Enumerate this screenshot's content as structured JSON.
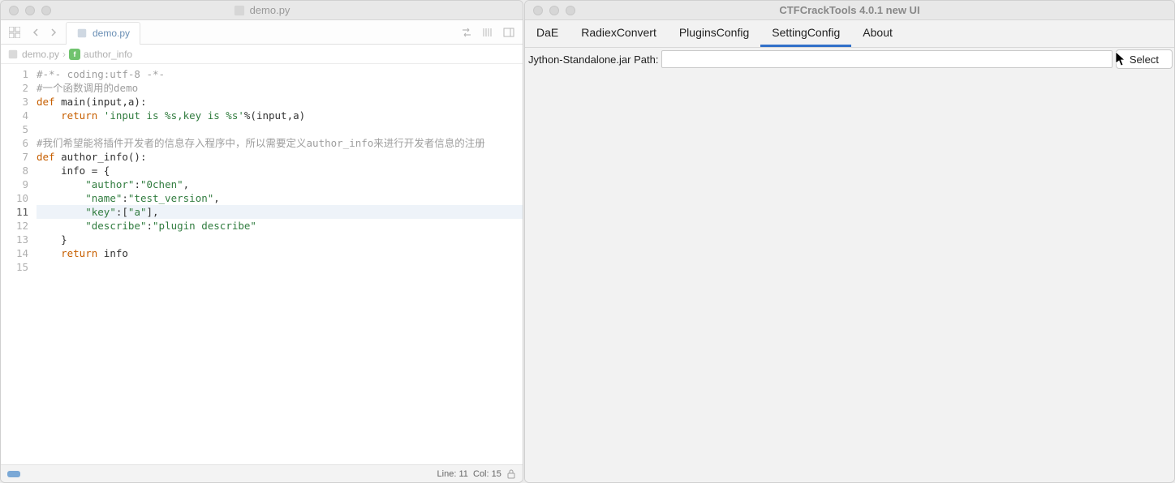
{
  "left": {
    "title": "demo.py",
    "tab_label": "demo.py",
    "breadcrumb": {
      "file": "demo.py",
      "symbol": "author_info"
    },
    "code": {
      "lines": [
        {
          "n": 1,
          "tokens": [
            {
              "t": "#-*- coding:utf-8 -*-",
              "c": "comment"
            }
          ]
        },
        {
          "n": 2,
          "tokens": [
            {
              "t": "#一个函数调用的demo",
              "c": "comment"
            }
          ]
        },
        {
          "n": 3,
          "tokens": [
            {
              "t": "def ",
              "c": "keyword"
            },
            {
              "t": "main(input,a):",
              "c": "text"
            }
          ]
        },
        {
          "n": 4,
          "tokens": [
            {
              "t": "    ",
              "c": "text"
            },
            {
              "t": "return ",
              "c": "keyword"
            },
            {
              "t": "'input is %s,key is %s'",
              "c": "string"
            },
            {
              "t": "%(input,a)",
              "c": "text"
            }
          ]
        },
        {
          "n": 5,
          "tokens": []
        },
        {
          "n": 6,
          "tokens": [
            {
              "t": "#我们希望能将插件开发者的信息存入程序中，所以需要定义author_info来进行开发者信息的注册",
              "c": "comment"
            }
          ]
        },
        {
          "n": 7,
          "tokens": [
            {
              "t": "def ",
              "c": "keyword"
            },
            {
              "t": "author_info():",
              "c": "text"
            }
          ]
        },
        {
          "n": 8,
          "tokens": [
            {
              "t": "    info = {",
              "c": "text"
            }
          ]
        },
        {
          "n": 9,
          "tokens": [
            {
              "t": "        ",
              "c": "text"
            },
            {
              "t": "\"author\"",
              "c": "string"
            },
            {
              "t": ":",
              "c": "text"
            },
            {
              "t": "\"0chen\"",
              "c": "string"
            },
            {
              "t": ",",
              "c": "text"
            }
          ]
        },
        {
          "n": 10,
          "tokens": [
            {
              "t": "        ",
              "c": "text"
            },
            {
              "t": "\"name\"",
              "c": "string"
            },
            {
              "t": ":",
              "c": "text"
            },
            {
              "t": "\"test_version\"",
              "c": "string"
            },
            {
              "t": ",",
              "c": "text"
            }
          ]
        },
        {
          "n": 11,
          "active": true,
          "tokens": [
            {
              "t": "        ",
              "c": "text"
            },
            {
              "t": "\"key\"",
              "c": "string"
            },
            {
              "t": ":[",
              "c": "text"
            },
            {
              "t": "\"a\"",
              "c": "string"
            },
            {
              "t": "],",
              "c": "text"
            }
          ]
        },
        {
          "n": 12,
          "tokens": [
            {
              "t": "        ",
              "c": "text"
            },
            {
              "t": "\"describe\"",
              "c": "string"
            },
            {
              "t": ":",
              "c": "text"
            },
            {
              "t": "\"plugin describe\"",
              "c": "string"
            }
          ]
        },
        {
          "n": 13,
          "tokens": [
            {
              "t": "    }",
              "c": "text"
            }
          ]
        },
        {
          "n": 14,
          "tokens": [
            {
              "t": "    ",
              "c": "text"
            },
            {
              "t": "return ",
              "c": "keyword"
            },
            {
              "t": "info",
              "c": "text"
            }
          ]
        },
        {
          "n": 15,
          "tokens": []
        }
      ]
    },
    "status": {
      "line_label": "Line:",
      "line": "11",
      "col_label": "Col:",
      "col": "15"
    }
  },
  "right": {
    "title": "CTFCrackTools 4.0.1 new UI",
    "tabs": [
      "DaE",
      "RadiexConvert",
      "PluginsConfig",
      "SettingConfig",
      "About"
    ],
    "active_tab": "SettingConfig",
    "path_label": "Jython-Standalone.jar Path:",
    "path_value": "",
    "select_label": "Select"
  }
}
